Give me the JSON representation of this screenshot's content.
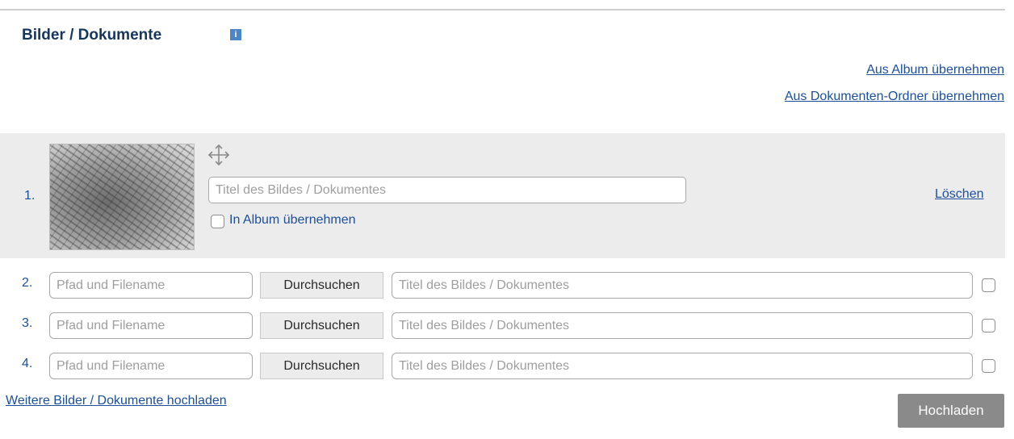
{
  "section": {
    "title": "Bilder / Dokumente",
    "info_icon": "i"
  },
  "links": {
    "from_album": "Aus Album übernehmen",
    "from_documents": "Aus Dokumenten-Ordner übernehmen",
    "more_uploads": "Weitere Bilder / Dokumente hochladen"
  },
  "existing_item": {
    "number": "1.",
    "title_placeholder": "Titel des Bildes / Dokumentes",
    "title_value": "",
    "album_checkbox_label": "In Album übernehmen",
    "album_checked": false,
    "delete_label": "Löschen",
    "thumbnail_icon": "city-engraving-image",
    "move_icon": "move-icon"
  },
  "upload_rows": [
    {
      "number": "2.",
      "path_placeholder": "Pfad und Filename",
      "browse_label": "Durchsuchen",
      "title_placeholder": "Titel des Bildes / Dokumentes",
      "checked": false
    },
    {
      "number": "3.",
      "path_placeholder": "Pfad und Filename",
      "browse_label": "Durchsuchen",
      "title_placeholder": "Titel des Bildes / Dokumentes",
      "checked": false
    },
    {
      "number": "4.",
      "path_placeholder": "Pfad und Filename",
      "browse_label": "Durchsuchen",
      "title_placeholder": "Titel des Bildes / Dokumentes",
      "checked": false
    }
  ],
  "upload_button": "Hochladen",
  "colors": {
    "title": "#17365d",
    "link": "#1c4f9c",
    "row_background": "#ececec",
    "upload_button": "#8a8a8a",
    "info_icon": "#4d86c8"
  }
}
